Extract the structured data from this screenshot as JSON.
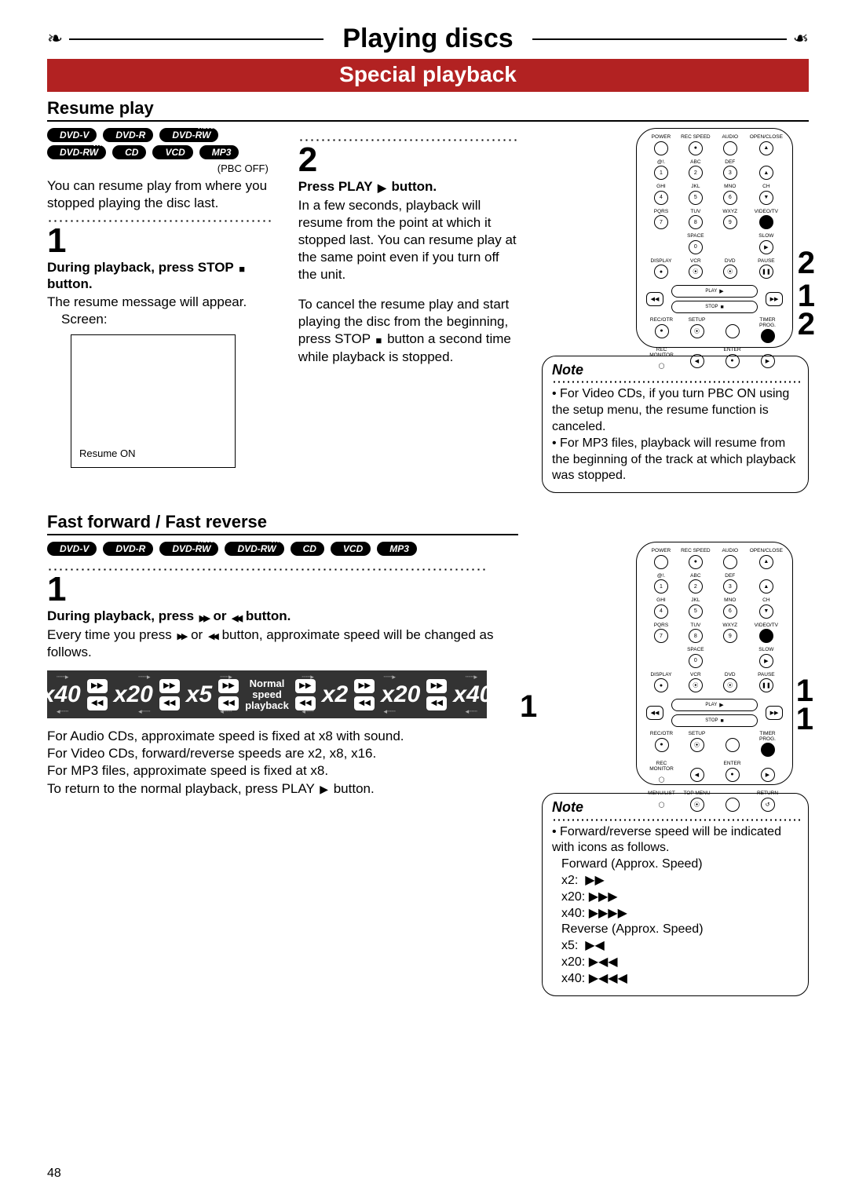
{
  "page": {
    "title": "Playing discs",
    "subtitle": "Special playback",
    "page_number": "48"
  },
  "resume": {
    "heading": "Resume play",
    "badges_row1": [
      "DVD-V",
      "DVD-R",
      "DVD-RW"
    ],
    "badges_row1_sup": [
      "",
      "",
      "Video"
    ],
    "badges_row2": [
      "DVD-RW",
      "CD",
      "VCD",
      "MP3"
    ],
    "badges_row2_sup": [
      "VR",
      "",
      "",
      ""
    ],
    "pbc_caption": "(PBC OFF)",
    "intro": "You can resume play from where you stopped playing the disc last.",
    "step1_num": "1",
    "step1_heading_a": "During playback, press STOP",
    "step1_heading_b": " button.",
    "step1_body": "The resume message will appear.",
    "step1_screen_label": "Screen:",
    "step1_resume_on": "Resume ON",
    "step2_num": "2",
    "step2_heading_a": "Press PLAY ",
    "step2_heading_b": " button.",
    "step2_body1": "In a few seconds, playback will resume from the point at which it stopped last. You can resume play at the same point even if you turn off the unit.",
    "step2_body2a": "To cancel the resume play and start playing the disc from the beginning, press STOP ",
    "step2_body2b": " button a second time while playback is stopped.",
    "note_title": "Note",
    "note_items": [
      "For Video CDs, if you turn PBC ON using the setup menu, the resume function is canceled.",
      "For MP3 files, playback will resume from the beginning of the track at which playback was stopped."
    ]
  },
  "ffr": {
    "heading": "Fast forward / Fast reverse",
    "badges": [
      "DVD-V",
      "DVD-R",
      "DVD-RW",
      "DVD-RW",
      "CD",
      "VCD",
      "MP3"
    ],
    "badges_sup": [
      "",
      "",
      "Video",
      "VR",
      "",
      "",
      ""
    ],
    "step1_num": "1",
    "step1_heading_a": "During playback, press ",
    "step1_heading_b": " or ",
    "step1_heading_c": " button.",
    "step1_body_a": "Every time you press ",
    "step1_body_b": " or ",
    "step1_body_c": " button, approximate speed will be changed as follows.",
    "speeds_left": [
      "x40",
      "x20",
      "x5"
    ],
    "speeds_mid": "Normal speed playback",
    "speeds_right": [
      "x2",
      "x20",
      "x40"
    ],
    "after_lines": [
      "For Audio CDs, approximate speed is fixed at x8 with sound.",
      "For Video CDs, forward/reverse speeds are x2, x8, x16.",
      "For MP3 files, approximate speed is fixed at x8."
    ],
    "return_line_a": "To return to the normal playback, press PLAY ",
    "return_line_b": " button.",
    "note_title": "Note",
    "note_intro": "Forward/reverse speed will be indicated with icons as follows.",
    "note_fwd_header": "Forward (Approx. Speed)",
    "note_fwd": [
      "x2:",
      "x20:",
      "x40:"
    ],
    "note_rev_header": "Reverse (Approx. Speed)",
    "note_rev": [
      "x5:",
      "x20:",
      "x40:"
    ]
  },
  "remote": {
    "rows": [
      [
        "POWER",
        "REC SPEED",
        "AUDIO",
        "OPEN/CLOSE"
      ],
      [
        "@!.",
        "ABC",
        "DEF",
        ""
      ],
      [
        "1",
        "2",
        "3",
        "▲"
      ],
      [
        "GHI",
        "JKL",
        "MNO",
        "CH"
      ],
      [
        "4",
        "5",
        "6",
        "▼"
      ],
      [
        "PQRS",
        "TUV",
        "WXYZ",
        "VIDEO/TV"
      ],
      [
        "7",
        "8",
        "9",
        "●"
      ],
      [
        "",
        "SPACE",
        "",
        "SLOW"
      ],
      [
        "",
        "0",
        "",
        "▶"
      ],
      [
        "DISPLAY",
        "VCR",
        "DVD",
        "PAUSE"
      ],
      [
        "●",
        "⦿",
        "⦿",
        "❚❚"
      ]
    ],
    "play_label": "PLAY",
    "stop_label": "STOP",
    "row_bottom1": [
      "REC/OTR",
      "SETUP",
      "",
      "TIMER PROG."
    ],
    "row_bottom2": [
      "REC MONITOR",
      "",
      "ENTER",
      ""
    ],
    "row_bottom3": [
      "MENU/LIST",
      "TOP MENU",
      "",
      "RETURN"
    ],
    "callouts_resume": [
      "2",
      "1",
      "2"
    ],
    "callouts_ffr_left": "1",
    "callouts_ffr_right": [
      "1",
      "1"
    ]
  }
}
